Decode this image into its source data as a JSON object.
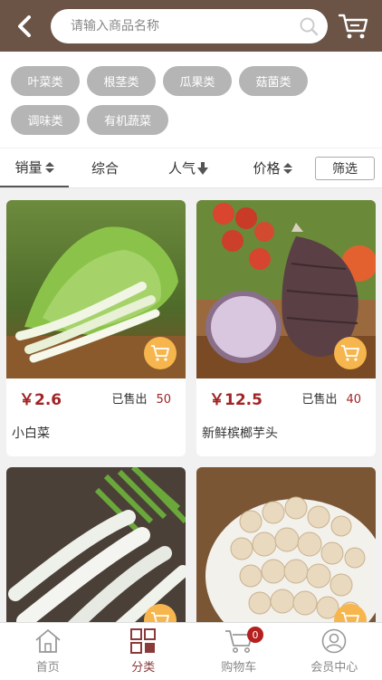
{
  "header": {
    "search_placeholder": "请输入商品名称"
  },
  "tags": [
    "叶菜类",
    "根茎类",
    "瓜果类",
    "菇菌类",
    "调味类",
    "有机蔬菜"
  ],
  "sortbar": {
    "sales": "销量",
    "overall": "综合",
    "popularity": "人气",
    "price": "价格",
    "filter": "筛选"
  },
  "products": [
    {
      "price": "￥2.6",
      "sold_label": "已售出",
      "sold": "50",
      "name": "小白菜"
    },
    {
      "price": "￥12.5",
      "sold_label": "已售出",
      "sold": "40",
      "name": "新鲜槟榔芋头"
    },
    {
      "price": "",
      "sold_label": "",
      "sold": "",
      "name": ""
    },
    {
      "price": "",
      "sold_label": "",
      "sold": "",
      "name": ""
    }
  ],
  "nav": {
    "home": "首页",
    "category": "分类",
    "cart": "购物车",
    "cart_count": "0",
    "member": "会员中心"
  },
  "colors": {
    "header_bg": "#6b5446",
    "accent": "#a12426",
    "tag_bg": "#b5b5b5",
    "cart_badge": "#f6b64d"
  }
}
